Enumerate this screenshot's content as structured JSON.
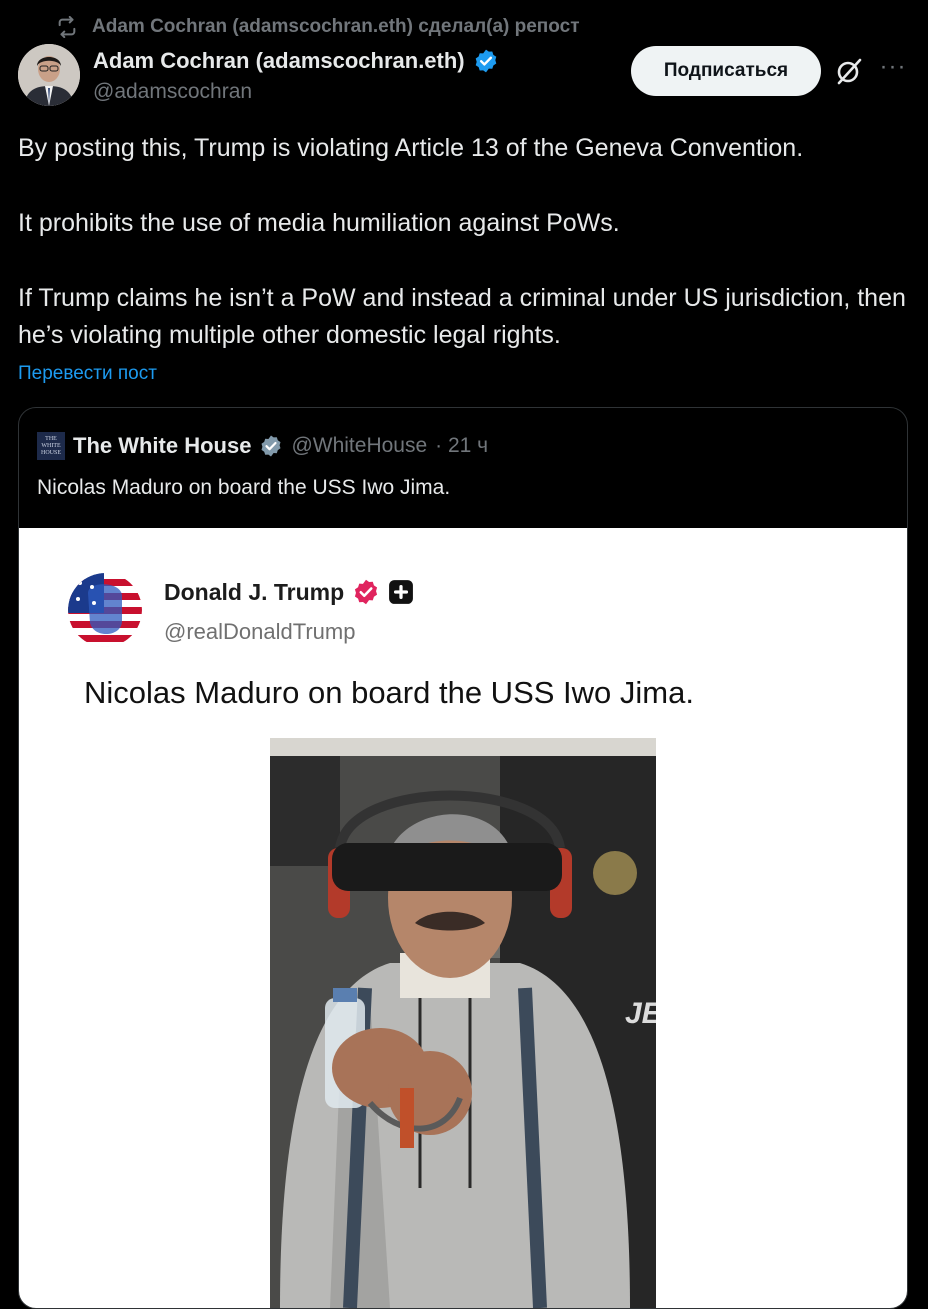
{
  "repost": {
    "label": "Adam Cochran (adamscochran.eth) сделал(а) репост",
    "icon": "repost-icon"
  },
  "author": {
    "name": "Adam Cochran (adamscochran.eth)",
    "handle": "@adamscochran",
    "verified": true,
    "verified_color": "#1d9bf0"
  },
  "actions": {
    "follow_label": "Подписаться",
    "grok_icon": "grok-icon",
    "more_icon": "more-icon",
    "more_label": "···"
  },
  "tweet": {
    "paragraphs": [
      "By posting this, Trump is violating Article 13 of the Geneva Convention.",
      "It prohibits the use of media humiliation against PoWs.",
      "If Trump claims he isn’t a PoW and instead a criminal under US jurisdiction, then he’s violating multiple other domestic legal rights."
    ],
    "translate_label": "Перевести пост",
    "link_color": "#1d9bf0"
  },
  "quote": {
    "name": "The White House",
    "handle": "@WhiteHouse",
    "time": "· 21 ч",
    "text": "Nicolas Maduro on board the USS Iwo Jima.",
    "logo_text": "THE WHITE HOUSE",
    "embed": {
      "name": "Donald J. Trump",
      "handle": "@realDonaldTrump",
      "text": "Nicolas Maduro on board the USS Iwo Jima.",
      "badge_color": "#e0245e",
      "photo_text": "JE"
    }
  }
}
